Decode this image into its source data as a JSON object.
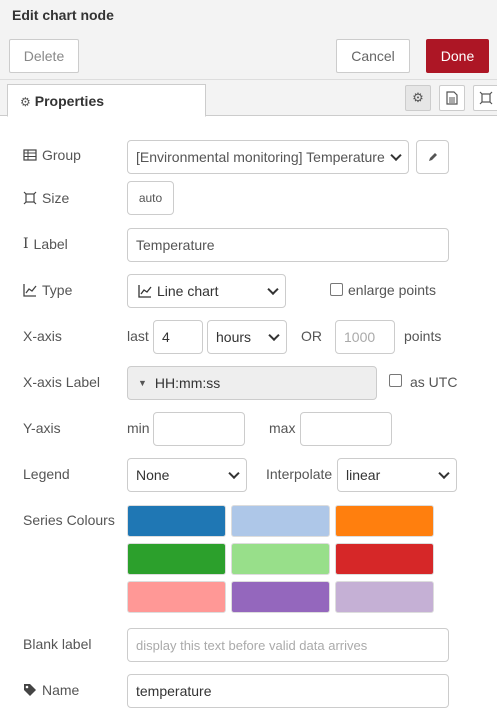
{
  "dialog": {
    "title": "Edit chart node"
  },
  "buttons": {
    "delete": "Delete",
    "cancel": "Cancel",
    "done": "Done"
  },
  "tabs": {
    "properties": "Properties"
  },
  "group": {
    "label": "Group",
    "value": "[Environmental monitoring] Temperature"
  },
  "size": {
    "label": "Size",
    "value": "auto"
  },
  "label_field": {
    "label": "Label",
    "value": "Temperature"
  },
  "type": {
    "label": "Type",
    "value": "Line chart",
    "enlarge_points": "enlarge points"
  },
  "xaxis": {
    "label": "X-axis",
    "last": "last",
    "amount": "4",
    "unit": "hours",
    "or": "OR",
    "points_placeholder": "1000",
    "points": "points"
  },
  "xaxis_label": {
    "label": "X-axis Label",
    "value": "HH:mm:ss",
    "as_utc": "as UTC"
  },
  "yaxis": {
    "label": "Y-axis",
    "min": "min",
    "max": "max"
  },
  "legend": {
    "label": "Legend",
    "value": "None",
    "interpolate_label": "Interpolate",
    "interpolate_value": "linear"
  },
  "series_colours": {
    "label": "Series Colours",
    "colors": [
      "#1f77b4",
      "#aec7e8",
      "#ff7f0e",
      "#2ca02c",
      "#98df8a",
      "#d62728",
      "#ff9896",
      "#9467bd",
      "#c5b0d5"
    ]
  },
  "blank_label": {
    "label": "Blank label",
    "placeholder": "display this text before valid data arrives"
  },
  "name": {
    "label": "Name",
    "value": "temperature"
  }
}
